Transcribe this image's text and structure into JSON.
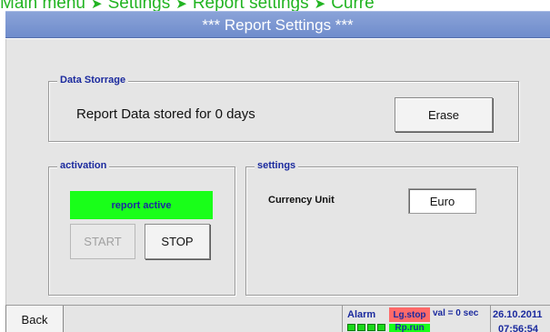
{
  "breadcrumb": {
    "items": [
      "Main menu",
      "Settings",
      "Report settings",
      "Curre"
    ],
    "separator_icon": "green-arrow-icon"
  },
  "title": "*** Report Settings ***",
  "data_storage": {
    "label": "Data Storrage",
    "text": "Report Data stored for  0 days",
    "erase_label": "Erase"
  },
  "activation": {
    "label": "activation",
    "status_text": "report active",
    "start_label": "START",
    "stop_label": "STOP"
  },
  "settings": {
    "label": "settings",
    "currency_label": "Currency Unit",
    "currency_value": "Euro"
  },
  "statusbar": {
    "back_label": "Back",
    "alarm_label": "Alarm",
    "lg_stop_label": "Lg.stop",
    "rp_run_label": "Rp.run",
    "val_label": "val = 0 sec",
    "date": "26.10.2011",
    "time": "07:56:54"
  },
  "colors": {
    "breadcrumb": "#22b422",
    "title_bar": "#7b96d2",
    "group_label": "#1b2a9e",
    "active_indicator": "#19ff19",
    "lg_stop": "#ff6a6a"
  }
}
